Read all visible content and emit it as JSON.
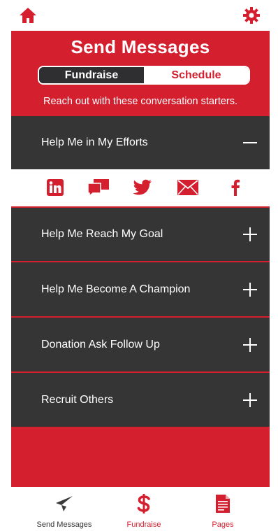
{
  "colors": {
    "brand": "#d41f2f",
    "dark": "#353536",
    "white": "#ffffff"
  },
  "header": {
    "title": "Send Messages",
    "tabs": [
      {
        "label": "Fundraise",
        "active": true
      },
      {
        "label": "Schedule",
        "active": false
      }
    ],
    "subtitle": "Reach out with these conversation starters."
  },
  "accordion": [
    {
      "label": "Help Me in My Efforts",
      "expanded": true,
      "icon": "minus-icon"
    },
    {
      "label": "Help Me Reach My Goal",
      "expanded": false,
      "icon": "plus-icon"
    },
    {
      "label": "Help Me Become A Champion",
      "expanded": false,
      "icon": "plus-icon"
    },
    {
      "label": "Donation Ask Follow Up",
      "expanded": false,
      "icon": "plus-icon"
    },
    {
      "label": "Recruit Others",
      "expanded": false,
      "icon": "plus-icon"
    }
  ],
  "share_icons": [
    "linkedin-icon",
    "message-icon",
    "twitter-icon",
    "email-icon",
    "facebook-icon"
  ],
  "tabbar": [
    {
      "label": "Send Messages",
      "icon": "paper-plane-icon"
    },
    {
      "label": "Fundraise",
      "icon": "dollar-icon"
    },
    {
      "label": "Pages",
      "icon": "document-icon"
    }
  ],
  "topbar": {
    "left_icon": "home-icon",
    "right_icon": "gear-icon"
  }
}
